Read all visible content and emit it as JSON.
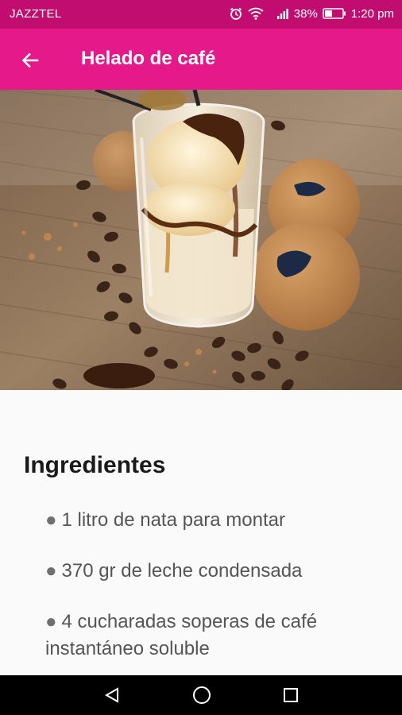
{
  "status_bar": {
    "carrier": "JAZZTEL",
    "battery": "38%",
    "time": "1:20 pm",
    "background": "#c20d70",
    "icons": [
      "alarm-icon",
      "wifi-icon",
      "signal-icon",
      "battery-icon"
    ]
  },
  "app_bar": {
    "title": "Helado de café",
    "back_icon": "arrow-back-icon",
    "background": "#e5198a"
  },
  "hero": {
    "image": "coffee ice cream glass with cookies and coffee beans"
  },
  "content": {
    "section_title": "Ingredientes",
    "bullet": "●",
    "ingredients": [
      "1 litro de nata para montar",
      "370 gr de leche condensada",
      "4 cucharadas soperas de café instantáneo soluble"
    ]
  },
  "nav_bar": {
    "buttons": [
      "back-triangle-icon",
      "home-circle-icon",
      "recents-square-icon"
    ]
  }
}
